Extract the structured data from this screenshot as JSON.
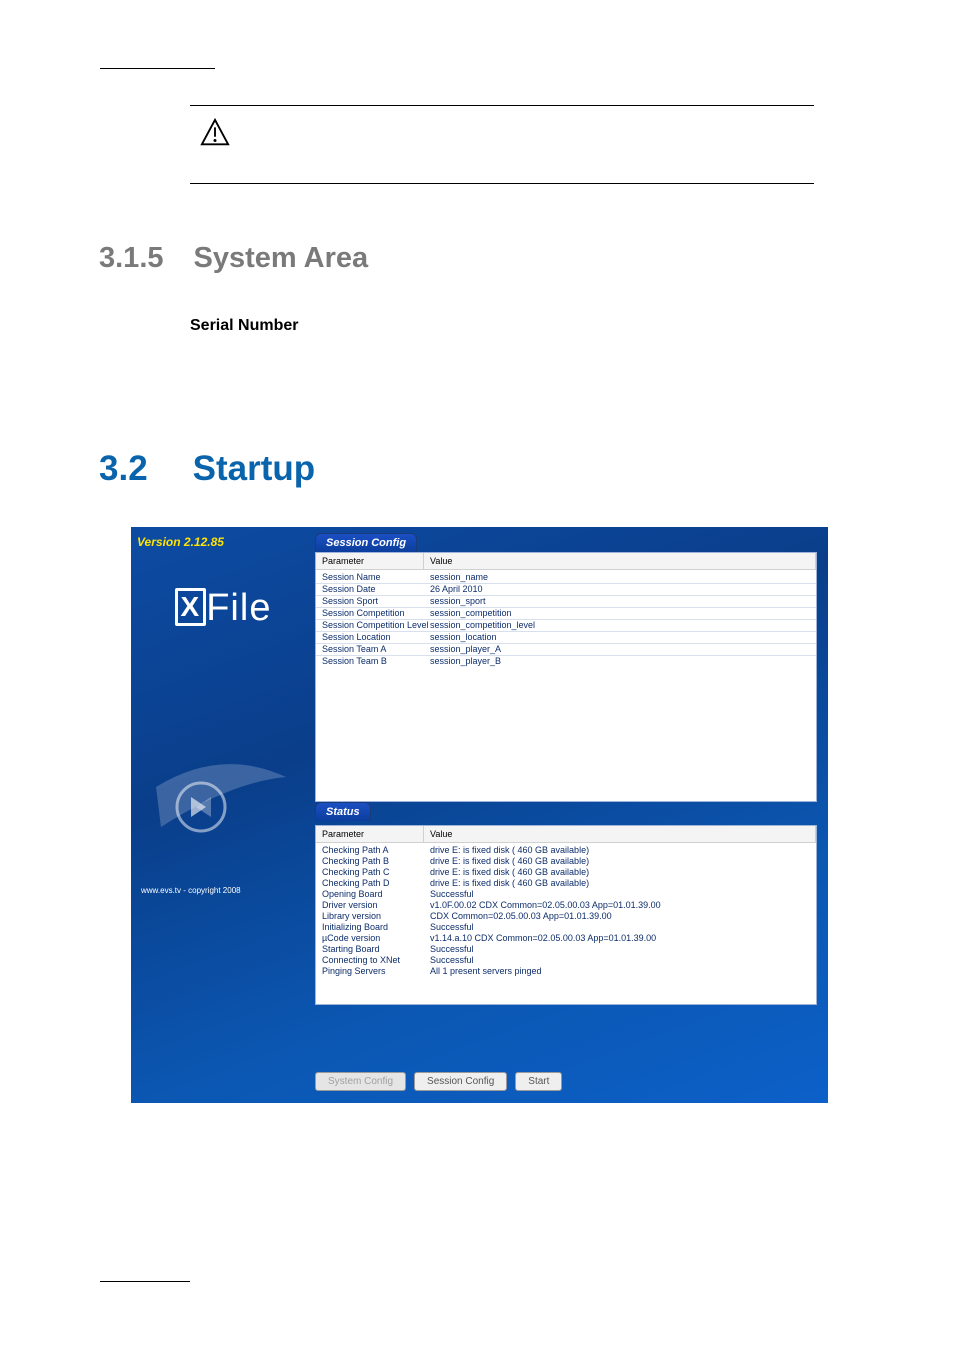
{
  "headings": {
    "sys_num": "3.1.5",
    "sys_title": "System  Area",
    "serial": "Serial  Number",
    "startup_num": "3.2",
    "startup_title": "Startup"
  },
  "app": {
    "version": "Version 2.12.85",
    "logo_text": "File",
    "copyright": "www.evs.tv - copyright 2008",
    "session_tab": "Session Config",
    "status_tab": "Status",
    "col_param": "Parameter",
    "col_value": "Value",
    "session_rows": [
      {
        "p": "Session Name",
        "v": "session_name"
      },
      {
        "p": "Session Date",
        "v": "26 April 2010"
      },
      {
        "p": "Session Sport",
        "v": "session_sport"
      },
      {
        "p": "Session Competition",
        "v": "session_competition"
      },
      {
        "p": "Session Competition Level",
        "v": "session_competition_level"
      },
      {
        "p": "Session Location",
        "v": "session_location"
      },
      {
        "p": "Session Team A",
        "v": "session_player_A"
      },
      {
        "p": "Session Team B",
        "v": "session_player_B"
      }
    ],
    "status_rows": [
      {
        "p": "Checking Path A",
        "v": "drive E: is fixed disk ( 460 GB available)"
      },
      {
        "p": "Checking Path B",
        "v": "drive E: is fixed disk ( 460 GB available)"
      },
      {
        "p": "Checking Path C",
        "v": "drive E: is fixed disk ( 460 GB available)"
      },
      {
        "p": "Checking Path D",
        "v": "drive E: is fixed disk ( 460 GB available)"
      },
      {
        "p": "Opening Board",
        "v": "Successful"
      },
      {
        "p": "Driver version",
        "v": "v1.0F.00.02  CDX Common=02.05.00.03 App=01.01.39.00"
      },
      {
        "p": "Library version",
        "v": "CDX Common=02.05.00.03 App=01.01.39.00"
      },
      {
        "p": "Initializing Board",
        "v": "Successful"
      },
      {
        "p": "µCode version",
        "v": "v1.14.a.10  CDX Common=02.05.00.03 App=01.01.39.00"
      },
      {
        "p": "Starting Board",
        "v": "Successful"
      },
      {
        "p": "Connecting to XNet",
        "v": "Successful"
      },
      {
        "p": "Pinging Servers",
        "v": "All 1 present servers pinged"
      }
    ],
    "btn_system": "System Config",
    "btn_session": "Session Config",
    "btn_start": "Start"
  }
}
